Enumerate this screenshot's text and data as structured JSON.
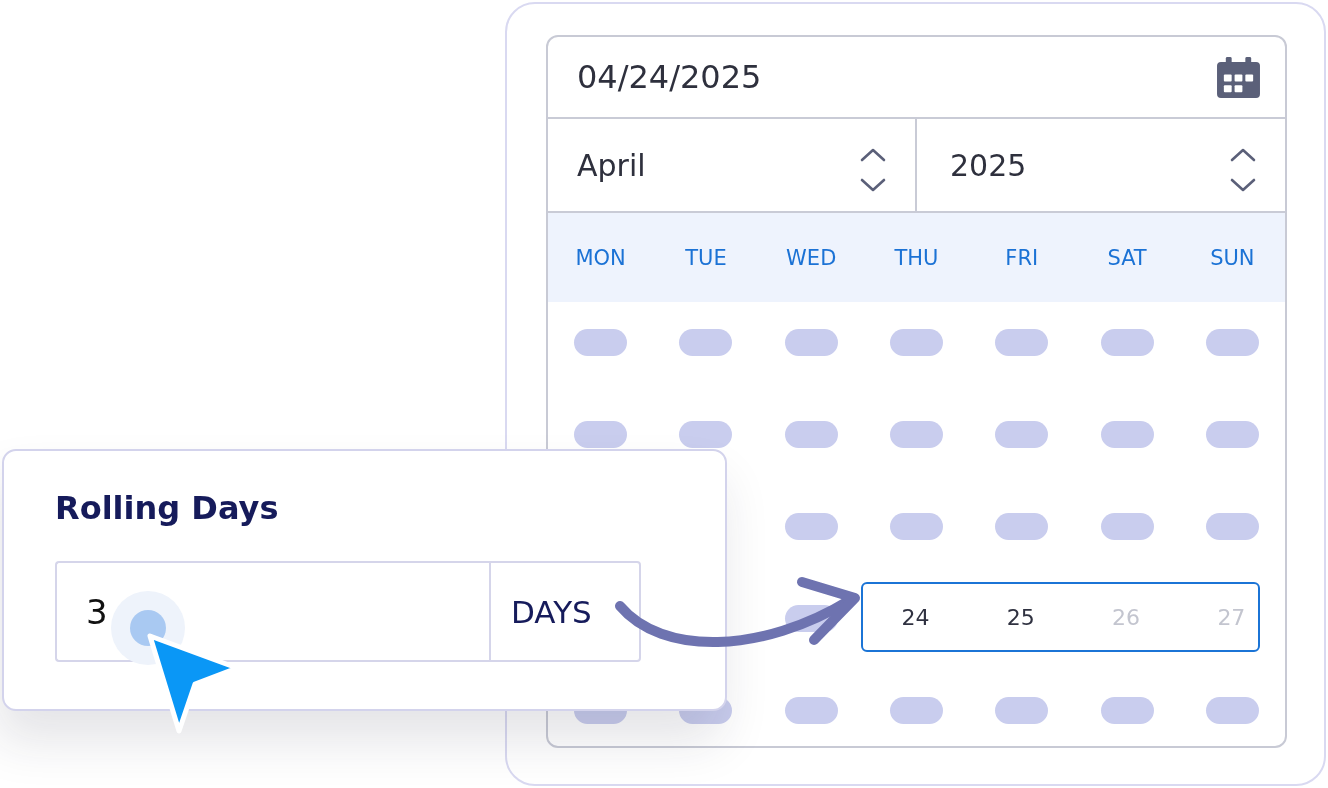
{
  "date_field": {
    "value": "04/24/2025"
  },
  "month_select": {
    "value": "April"
  },
  "year_select": {
    "value": "2025"
  },
  "weekdays": [
    "MON",
    "TUE",
    "WED",
    "THU",
    "FRI",
    "SAT",
    "SUN"
  ],
  "weeks": [
    {
      "days": [
        {
          "kind": "placeholder"
        },
        {
          "kind": "placeholder"
        },
        {
          "kind": "placeholder"
        },
        {
          "kind": "placeholder"
        },
        {
          "kind": "placeholder"
        },
        {
          "kind": "placeholder"
        },
        {
          "kind": "placeholder"
        }
      ]
    },
    {
      "days": [
        {
          "kind": "placeholder"
        },
        {
          "kind": "placeholder"
        },
        {
          "kind": "placeholder"
        },
        {
          "kind": "placeholder"
        },
        {
          "kind": "placeholder"
        },
        {
          "kind": "placeholder"
        },
        {
          "kind": "placeholder"
        }
      ]
    },
    {
      "days": [
        {
          "kind": "blank"
        },
        {
          "kind": "blank"
        },
        {
          "kind": "placeholder"
        },
        {
          "kind": "placeholder"
        },
        {
          "kind": "placeholder"
        },
        {
          "kind": "placeholder"
        },
        {
          "kind": "placeholder"
        }
      ]
    },
    {
      "days": [
        {
          "kind": "blank"
        },
        {
          "kind": "blank"
        },
        {
          "kind": "placeholder"
        },
        {
          "kind": "day",
          "label": "24",
          "selected": true,
          "disabled": false
        },
        {
          "kind": "day",
          "label": "25",
          "selected": true,
          "disabled": false
        },
        {
          "kind": "day",
          "label": "26",
          "selected": true,
          "disabled": true
        },
        {
          "kind": "day",
          "label": "27",
          "selected": true,
          "disabled": true
        }
      ]
    },
    {
      "days": [
        {
          "kind": "placeholder"
        },
        {
          "kind": "placeholder"
        },
        {
          "kind": "placeholder"
        },
        {
          "kind": "placeholder"
        },
        {
          "kind": "placeholder"
        },
        {
          "kind": "placeholder"
        },
        {
          "kind": "placeholder"
        }
      ]
    }
  ],
  "rolling_days": {
    "title": "Rolling Days",
    "value": "3",
    "unit": "DAYS"
  }
}
